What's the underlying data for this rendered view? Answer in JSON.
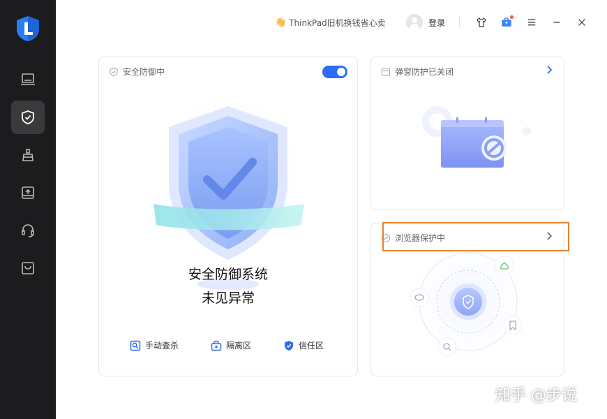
{
  "topbar": {
    "promo_text": "ThinkPad旧机换钱省心卖",
    "login_label": "登录"
  },
  "sidebar": {
    "items": [
      {
        "icon": "laptop-icon"
      },
      {
        "icon": "shield-check-icon",
        "active": true
      },
      {
        "icon": "broom-icon"
      },
      {
        "icon": "drive-upload-icon"
      },
      {
        "icon": "headset-icon"
      },
      {
        "icon": "bag-icon"
      }
    ]
  },
  "main_card": {
    "title": "安全防御中",
    "toggle_on": true,
    "status_line1": "安全防御系统",
    "status_line2": "未见异常",
    "actions": [
      {
        "label": "手动查杀",
        "icon": "manual-scan-icon"
      },
      {
        "label": "隔离区",
        "icon": "quarantine-icon"
      },
      {
        "label": "信任区",
        "icon": "trust-zone-icon"
      }
    ]
  },
  "popup_card": {
    "title": "弹窗防护已关闭"
  },
  "browser_card": {
    "title": "浏览器保护中"
  },
  "watermark": "知乎 @步说",
  "colors": {
    "accent": "#2b6cf5",
    "sidebar_bg": "#1c1c1e",
    "highlight": "#e8822e"
  }
}
